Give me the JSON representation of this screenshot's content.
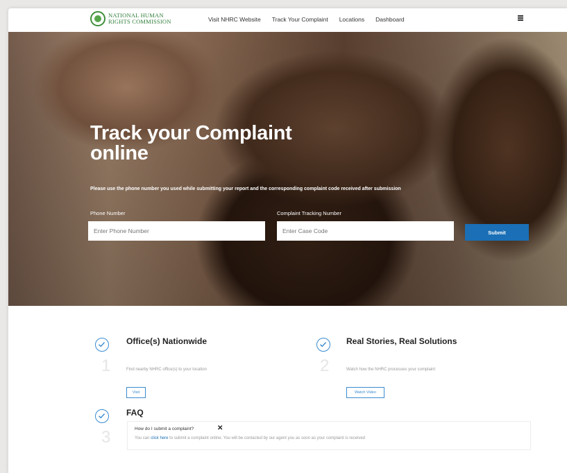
{
  "nav": {
    "logo_line1": "NATIONAL HUMAN",
    "logo_line2": "RIGHTS COMMISSION",
    "links": [
      "Visit NHRC Website",
      "Track Your Complaint",
      "Locations",
      "Dashboard"
    ]
  },
  "hero": {
    "title": "Track your Complaint online",
    "description": "Please use the phone number you used while submitting your report and the corresponding complaint code received after submission",
    "phone_label": "Phone Number",
    "phone_placeholder": "Enter Phone Number",
    "case_label": "Complaint Tracking Number",
    "case_placeholder": "Enter Case Code",
    "submit_label": "Submit"
  },
  "features": [
    {
      "number": "1",
      "title": "Office(s) Nationwide",
      "description": "Find nearby NHRC office(s) to your location",
      "button": "Visit"
    },
    {
      "number": "2",
      "title": "Real Stories, Real Solutions",
      "description": "Watch how the NHRC processes your complaint",
      "button": "Watch Video"
    },
    {
      "number": "3",
      "title": "FAQ"
    }
  ],
  "faq": {
    "question": "How do I submit a complaint?",
    "answer_prefix": "You can",
    "answer_link": "click here",
    "answer_suffix": "to submit a complaint online. You will be contacted by our agent you as soon as your complaint is received"
  },
  "colors": {
    "accent": "#1a6fb6",
    "check": "#3a8bd0",
    "logo_green": "#2f7d3a"
  }
}
